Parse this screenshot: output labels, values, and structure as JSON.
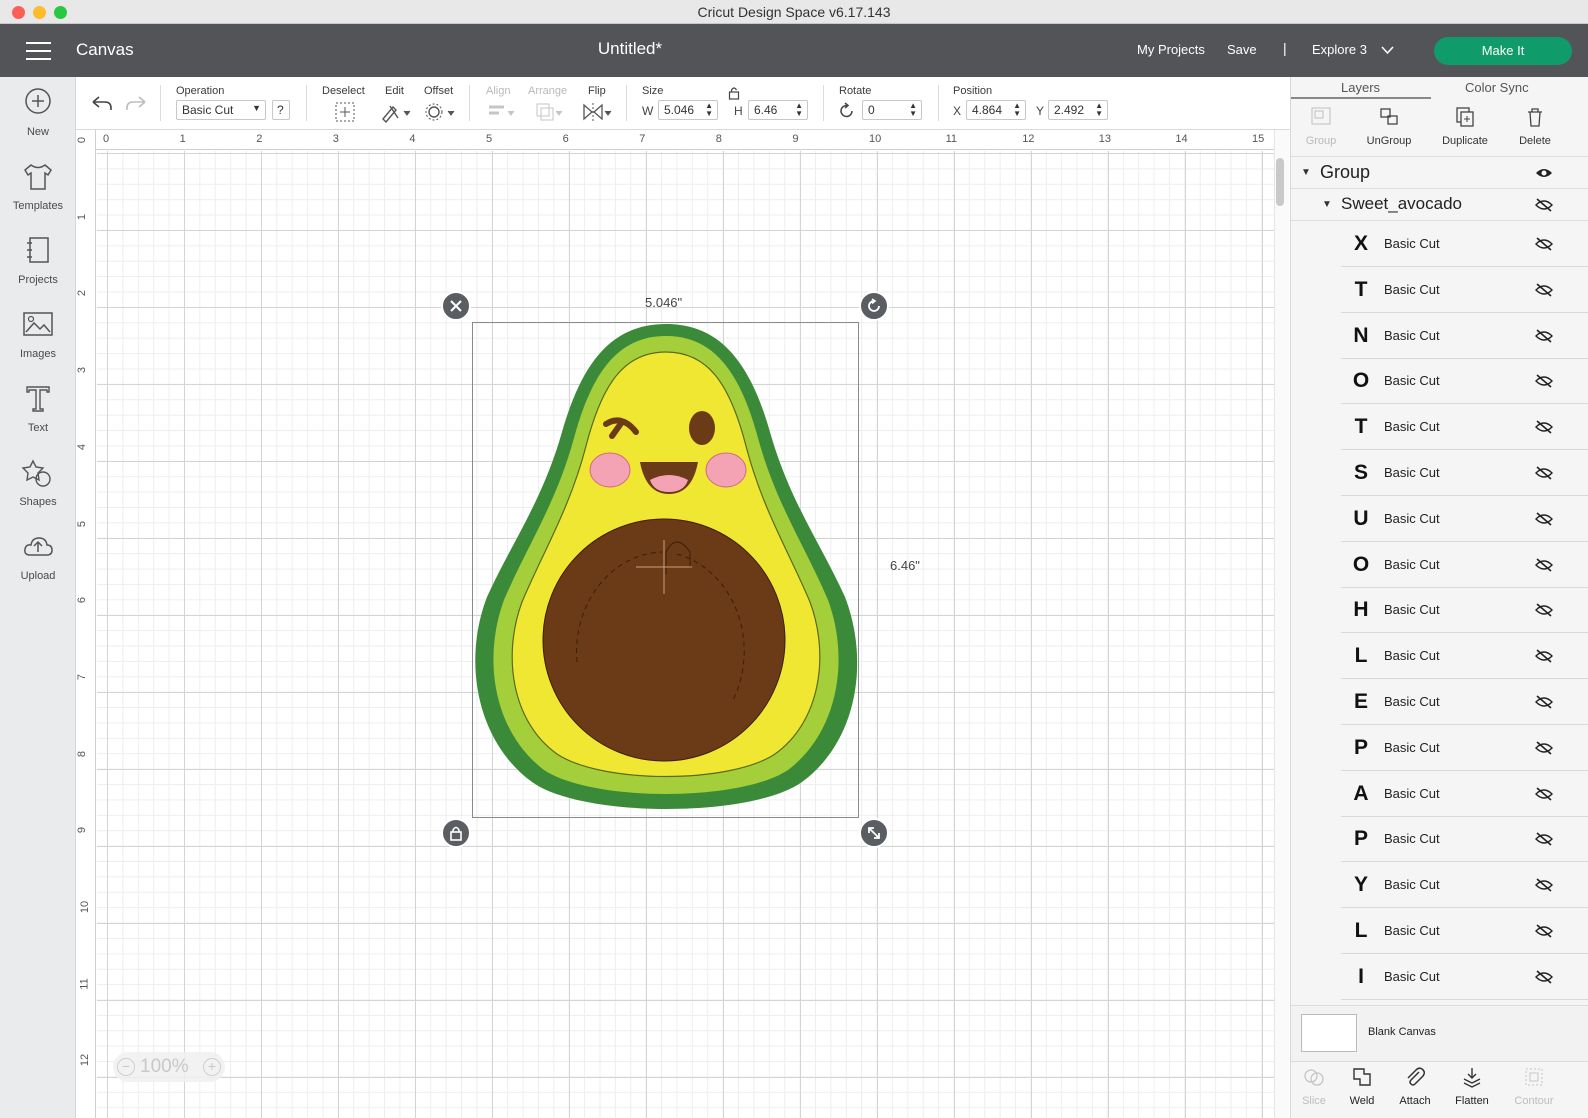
{
  "window": {
    "title": "Cricut Design Space  v6.17.143"
  },
  "topbar": {
    "section": "Canvas",
    "doc_title": "Untitled*",
    "my_projects": "My Projects",
    "save": "Save",
    "separator": "|",
    "machine": "Explore 3",
    "make_it": "Make It"
  },
  "sidebar": {
    "items": [
      {
        "label": "New",
        "icon": "plus-circle-icon"
      },
      {
        "label": "Templates",
        "icon": "shirt-icon"
      },
      {
        "label": "Projects",
        "icon": "notebook-icon"
      },
      {
        "label": "Images",
        "icon": "image-icon"
      },
      {
        "label": "Text",
        "icon": "text-icon"
      },
      {
        "label": "Shapes",
        "icon": "shapes-icon"
      },
      {
        "label": "Upload",
        "icon": "cloud-upload-icon"
      }
    ]
  },
  "toolbar": {
    "operation_label": "Operation",
    "operation_value": "Basic Cut",
    "help": "?",
    "deselect": "Deselect",
    "edit": "Edit",
    "offset": "Offset",
    "align": "Align",
    "arrange": "Arrange",
    "flip": "Flip",
    "size_label": "Size",
    "w_label": "W",
    "w_value": "5.046",
    "h_label": "H",
    "h_value": "6.46",
    "rotate_label": "Rotate",
    "rotate_value": "0",
    "position_label": "Position",
    "x_label": "X",
    "x_value": "4.864",
    "y_label": "Y",
    "y_value": "2.492"
  },
  "ruler": {
    "top": [
      "0",
      "1",
      "2",
      "3",
      "4",
      "5",
      "6",
      "7",
      "8",
      "9",
      "10",
      "11",
      "12",
      "13",
      "14",
      "15"
    ],
    "left": [
      "0",
      "1",
      "2",
      "3",
      "4",
      "5",
      "6",
      "7",
      "8",
      "9",
      "10",
      "11",
      "12"
    ]
  },
  "canvas": {
    "width_label": "5.046\"",
    "height_label": "6.46\"",
    "zoom": "100%",
    "colors": {
      "outer_green": "#3b8a3a",
      "light_green": "#a4cf3b",
      "flesh": "#f0e733",
      "pit": "#6b3a16",
      "cheek": "#f4a3b5"
    }
  },
  "panel": {
    "tabs": [
      "Layers",
      "Color Sync"
    ],
    "actions": [
      {
        "label": "Group",
        "enabled": false
      },
      {
        "label": "UnGroup",
        "enabled": true
      },
      {
        "label": "Duplicate",
        "enabled": true
      },
      {
        "label": "Delete",
        "enabled": true
      }
    ],
    "group_name": "Group",
    "subgroup_name": "Sweet_avocado",
    "layers": [
      {
        "letter": "X",
        "op": "Basic Cut"
      },
      {
        "letter": "T",
        "op": "Basic Cut"
      },
      {
        "letter": "N",
        "op": "Basic Cut"
      },
      {
        "letter": "O",
        "op": "Basic Cut"
      },
      {
        "letter": "T",
        "op": "Basic Cut"
      },
      {
        "letter": "S",
        "op": "Basic Cut"
      },
      {
        "letter": "U",
        "op": "Basic Cut"
      },
      {
        "letter": "O",
        "op": "Basic Cut"
      },
      {
        "letter": "H",
        "op": "Basic Cut"
      },
      {
        "letter": "L",
        "op": "Basic Cut"
      },
      {
        "letter": "E",
        "op": "Basic Cut"
      },
      {
        "letter": "P",
        "op": "Basic Cut"
      },
      {
        "letter": "A",
        "op": "Basic Cut"
      },
      {
        "letter": "P",
        "op": "Basic Cut"
      },
      {
        "letter": "Y",
        "op": "Basic Cut"
      },
      {
        "letter": "L",
        "op": "Basic Cut"
      },
      {
        "letter": "I",
        "op": "Basic Cut"
      }
    ],
    "blank_canvas": "Blank Canvas",
    "bottom_actions": [
      {
        "label": "Slice",
        "enabled": false
      },
      {
        "label": "Weld",
        "enabled": true
      },
      {
        "label": "Attach",
        "enabled": true
      },
      {
        "label": "Flatten",
        "enabled": true
      },
      {
        "label": "Contour",
        "enabled": false
      }
    ]
  }
}
